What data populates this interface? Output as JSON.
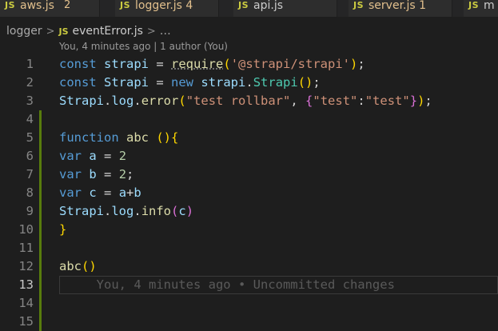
{
  "tabs": [
    {
      "icon": "JS",
      "name": "aws.js",
      "badge": "2"
    },
    {
      "icon": "JS",
      "name": "logger.js 4",
      "badge": ""
    },
    {
      "icon": "JS",
      "name": "api.js",
      "badge": ""
    },
    {
      "icon": "JS",
      "name": "server.js 1",
      "badge": ""
    },
    {
      "icon": "JS",
      "name": "m",
      "badge": ""
    }
  ],
  "breadcrumb": {
    "folder": "logger",
    "sep": ">",
    "file_icon": "JS",
    "file": "eventError.js",
    "tail": "…"
  },
  "codelens": "You, 4 minutes ago | 1 author (You)",
  "line_numbers": [
    "1",
    "2",
    "3",
    "4",
    "5",
    "6",
    "7",
    "8",
    "9",
    "10",
    "11",
    "12",
    "13",
    "14",
    "15"
  ],
  "code": {
    "l1": {
      "kw": "const",
      "sp": " ",
      "name": "strapi",
      "eq": " = ",
      "fn": "require",
      "open": "(",
      "str": "'@strapi/strapi'",
      "close": ")",
      "semi": ";"
    },
    "l2": {
      "kw": "const",
      "sp": " ",
      "name": "Strapi",
      "eq": " = ",
      "new": "new",
      "sp2": " ",
      "obj": "strapi",
      "dot": ".",
      "cls": "Strapi",
      "parens": "()",
      "semi": ";"
    },
    "l3": {
      "obj": "Strapi",
      "dot1": ".",
      "prop": "log",
      "dot2": ".",
      "fn": "error",
      "open": "(",
      "str1": "\"test rollbar\"",
      "comma": ", ",
      "bopen": "{",
      "key": "\"test\"",
      "colon": ":",
      "val": "\"test\"",
      "bclose": "}",
      "close": ")",
      "semi": ";"
    },
    "l5": {
      "kw": "function",
      "sp": " ",
      "fn": "abc",
      "sp2": " ",
      "parens": "()",
      "brace": "{"
    },
    "l6": {
      "kw": "var",
      "sp": " ",
      "name": "a",
      "eq": " = ",
      "num": "2"
    },
    "l7": {
      "kw": "var",
      "sp": " ",
      "name": "b",
      "eq": " = ",
      "num": "2",
      "semi": ";"
    },
    "l8": {
      "kw": "var",
      "sp": " ",
      "name": "c",
      "eq": " = ",
      "a": "a",
      "plus": "+",
      "b": "b"
    },
    "l9": {
      "obj": "Strapi",
      "dot1": ".",
      "prop": "log",
      "dot2": ".",
      "fn": "info",
      "open": "(",
      "arg": "c",
      "close": ")"
    },
    "l10": {
      "brace": "}"
    },
    "l12": {
      "fn": "abc",
      "parens": "()"
    },
    "l13": {
      "blame": "     You, 4 minutes ago • Uncommitted changes"
    }
  },
  "colors": {
    "background": "#1e1e1e",
    "keyword": "#569cd6",
    "variable": "#9cdcfe",
    "class": "#4ec9b0",
    "function": "#dcdcaa",
    "string": "#ce9178",
    "number": "#b5cea8",
    "bracket1": "#ffd700",
    "bracket2": "#da70d6",
    "modified_gutter": "#587c0c"
  }
}
